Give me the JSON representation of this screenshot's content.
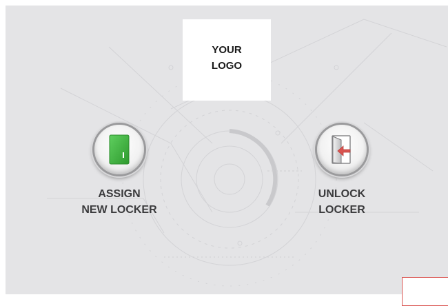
{
  "logo": {
    "line1": "YOUR",
    "line2": "LOGO"
  },
  "actions": [
    {
      "id": "assign",
      "line1": "ASSIGN",
      "line2": "NEW LOCKER",
      "icon": "green-locker-door-icon"
    },
    {
      "id": "unlock",
      "line1": "UNLOCK",
      "line2": "LOCKER",
      "icon": "open-door-arrow-icon"
    }
  ],
  "colors": {
    "background": "#e4e4e6",
    "label": "#3a3a3c",
    "locker_green": "#3cae3c",
    "arrow_red": "#d9534f",
    "frame": "#d9534f"
  }
}
